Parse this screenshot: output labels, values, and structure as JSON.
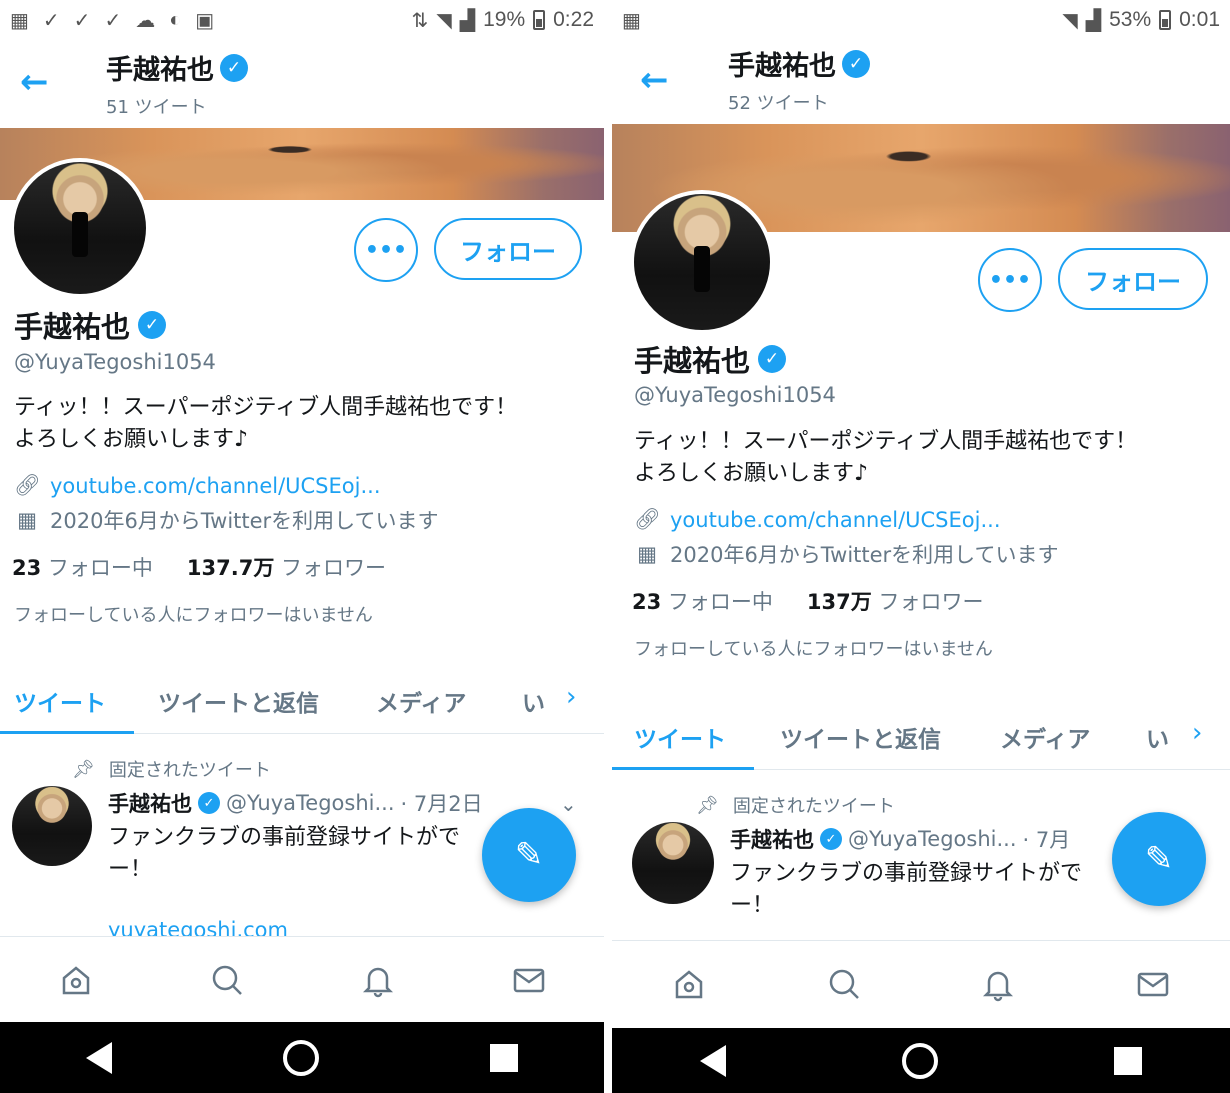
{
  "screens": [
    {
      "status": {
        "percent": "19%",
        "time": "0:22"
      },
      "header": {
        "name": "手越祐也",
        "tweet_count": "51 ツイート"
      },
      "profile": {
        "name": "手越祐也",
        "handle": "@YuyaTegoshi1054",
        "bio_line1": "ティッ！！スーパーポジティブ人間手越祐也です！",
        "bio_line2": "よろしくお願いします♪",
        "link": "youtube.com/channel/UCSEoj...",
        "joined": "2020年6月からTwitterを利用しています",
        "following_count": "23",
        "following_label": "フォロー中",
        "followers_count": "137.7万",
        "followers_label": "フォロワー",
        "no_followers_note": "フォローしている人にフォロワーはいません"
      },
      "buttons": {
        "more": "•••",
        "follow": "フォロー"
      },
      "tabs": [
        "ツイート",
        "ツイートと返信",
        "メディア",
        "い"
      ],
      "tweet": {
        "pinned_label": "固定されたツイート",
        "author": "手越祐也",
        "handle": "@YuyaTegoshi...",
        "date": "· 7月2日",
        "line1": "ファンクラブの事前登録サイトがで",
        "line2": "ー！",
        "link": "yuyategoshi.com"
      }
    },
    {
      "status": {
        "percent": "53%",
        "time": "0:01"
      },
      "header": {
        "name": "手越祐也",
        "tweet_count": "52 ツイート"
      },
      "profile": {
        "name": "手越祐也",
        "handle": "@YuyaTegoshi1054",
        "bio_line1": "ティッ！！スーパーポジティブ人間手越祐也です！",
        "bio_line2": "よろしくお願いします♪",
        "link": "youtube.com/channel/UCSEoj...",
        "joined": "2020年6月からTwitterを利用しています",
        "following_count": "23",
        "following_label": "フォロー中",
        "followers_count": "137万",
        "followers_label": "フォロワー",
        "no_followers_note": "フォローしている人にフォロワーはいません"
      },
      "buttons": {
        "more": "•••",
        "follow": "フォロー"
      },
      "tabs": [
        "ツイート",
        "ツイートと返信",
        "メディア",
        "い"
      ],
      "tweet": {
        "pinned_label": "固定されたツイート",
        "author": "手越祐也",
        "handle": "@YuyaTegoshi...",
        "date": "· 7月",
        "line1": "ファンクラブの事前登録サイトがで",
        "line2": "ー！",
        "link": ""
      }
    }
  ],
  "colors": {
    "accent": "#1da1f2",
    "text": "#14171a",
    "muted": "#657786",
    "border": "#e1e8ed",
    "system_nav": "#000000"
  },
  "icons": {
    "back": "arrow-left-icon",
    "verified": "verified-badge-icon",
    "link": "link-icon",
    "calendar": "calendar-icon",
    "pin": "pin-icon",
    "compose": "compose-feather-icon",
    "home": "home-icon",
    "search": "search-icon",
    "notifications": "bell-icon",
    "messages": "mail-icon"
  }
}
